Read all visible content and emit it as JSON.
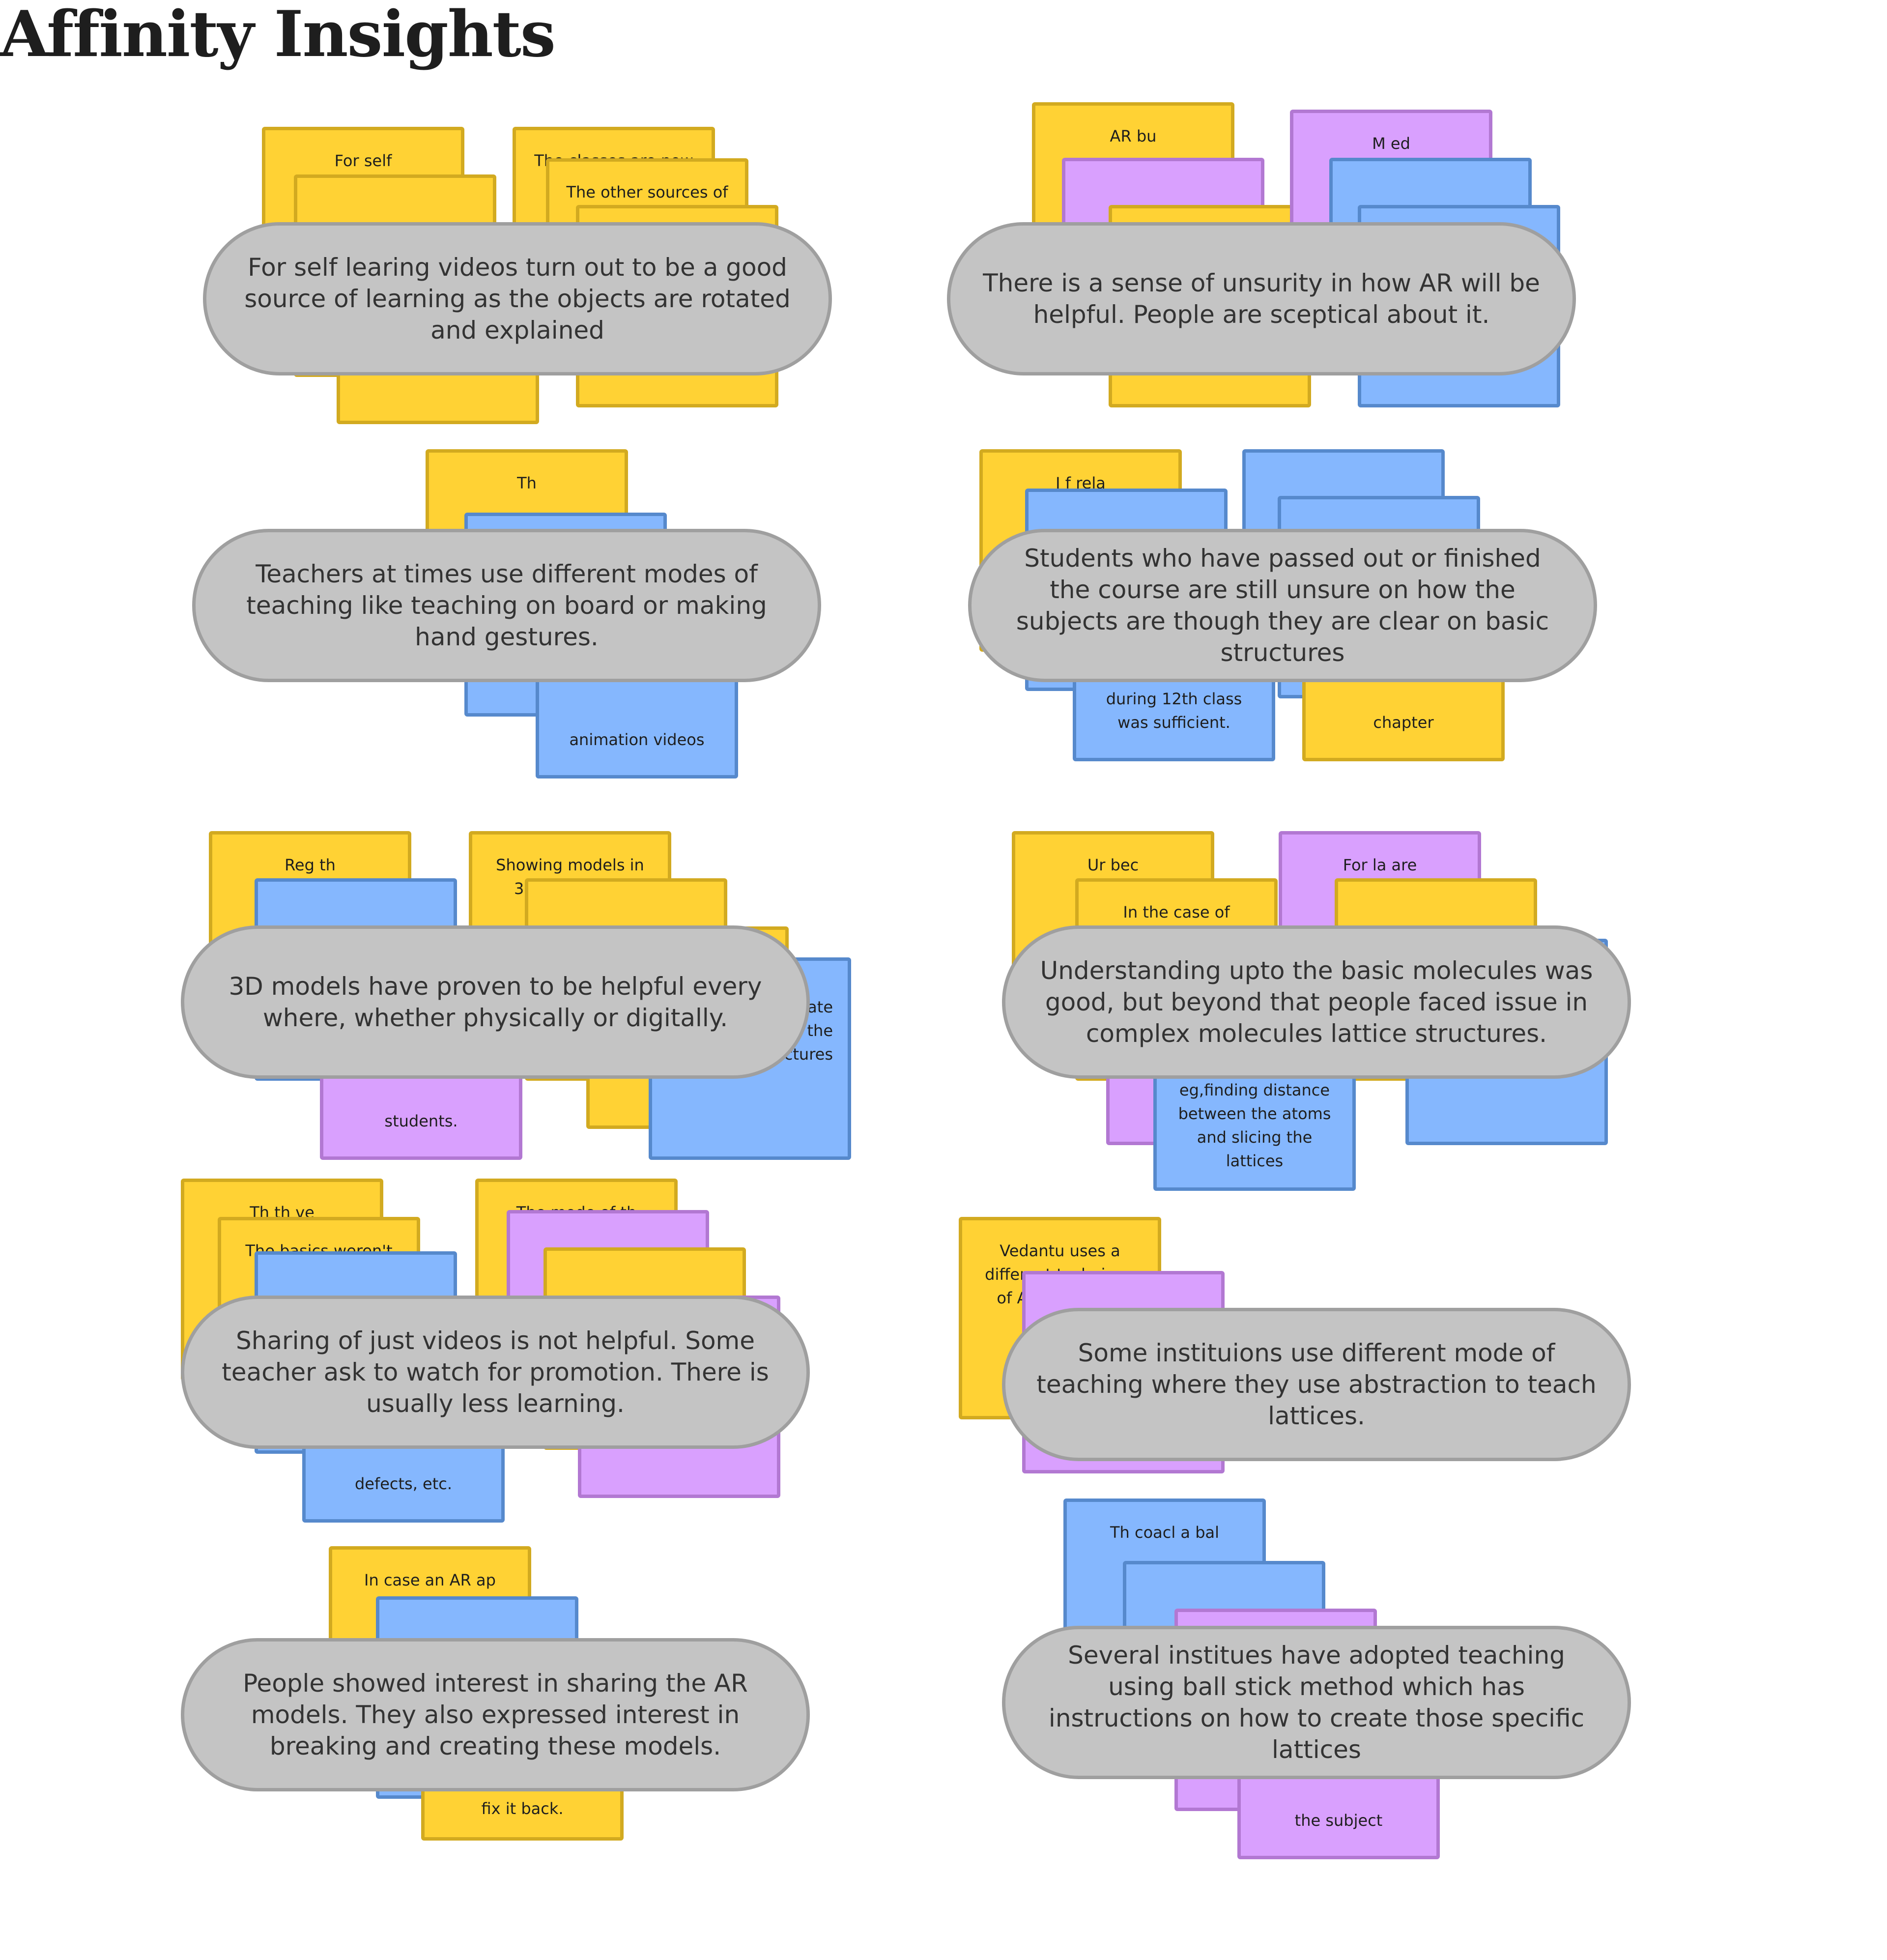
{
  "title": "Affinity Insights",
  "colors": {
    "yellow": "#ffd234",
    "blue": "#85b7fe",
    "purple": "#d9a0fe",
    "pill": "#c4c4c4"
  },
  "g1": {
    "n1": "For self understanding",
    "n2": "The classes are now",
    "n3": "The other sources of",
    "pill": "For self learing videos turn out to be a good source of learning as the objects are rotated and explained"
  },
  "g2": {
    "n1": "AR bu",
    "n2": "M ed",
    "pill": "There is a sense of unsurity in how AR will be helpful. People are sceptical about it."
  },
  "g3": {
    "n1": "Th",
    "n2": "animation videos",
    "pill": "Teachers at times use different modes of teaching like teaching on board or making hand gestures."
  },
  "g4": {
    "n1": "I f rela",
    "n2": "during 12th class was sufficient.",
    "n3": "chapter",
    "pill": "Students who have passed out or finished the course are still unsure on how the subjects are though they are clear on basic structures"
  },
  "g5": {
    "n1": "Reg th",
    "n2": "Showing models in 3D might teac",
    "n3": "students.",
    "n4": "sed eb d rotate around the structures",
    "pill": "3D models have proven to be helpful every where, whether physically or digitally."
  },
  "g6": {
    "n1": "Ur bec",
    "n2": "In the case of complex",
    "n3": "For la are",
    "n4": "tougher. For eg,finding distance between the atoms and slicing the lattices",
    "pill": "Understanding upto the basic molecules was good, but beyond that people faced issue in complex molecules lattice structures."
  },
  "g7": {
    "n1": "Th th ve",
    "n2": "The basics weren't cle",
    "n3": "The mode of th",
    "n4": "defects, etc.",
    "pill": "Sharing of just videos is not helpful. Some teacher ask to watch for promotion. There is usually less learning."
  },
  "g8": {
    "n1": "Vedantu uses a different technique of Abstra ato ho",
    "pill": "Some instituions use different mode of teaching where they use abstraction to teach lattices."
  },
  "g9": {
    "n1": "In case an AR ap",
    "n2": "fix it back.",
    "pill": "People showed interest in sharing the AR models. They also expressed interest in breaking and creating these models."
  },
  "g10": {
    "n1": "Th coacl a bal",
    "n2": "the subject",
    "pill": "Several institues have adopted teaching using ball stick method which has instructions on how to create those specific lattices"
  }
}
